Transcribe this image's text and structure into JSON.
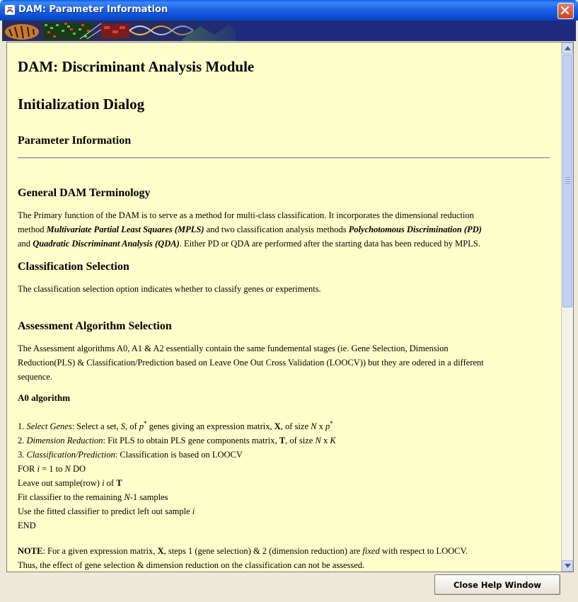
{
  "window": {
    "title": "DAM: Parameter Information"
  },
  "doc": {
    "title": "DAM: Discriminant Analysis Module",
    "subtitle": "Initialization Dialog",
    "section_title": "Parameter Information",
    "terminology": {
      "heading": "General DAM Terminology",
      "line1": "The Primary function of the DAM is to serve as a method for multi-class classification. It incorporates the dimensional reduction",
      "line2_pre": "method ",
      "line2_mpls": "Multivariate Partial Least Squares (MPLS)",
      "line2_mid": " and two classification analysis methods ",
      "line2_pd": "Polychotomous Discrimination (PD)",
      "line3_pre": "and ",
      "line3_qda": "Quadratic Discriminant Analysis (QDA)",
      "line3_post": ". Either PD or QDA are performed after the starting data has been reduced by MPLS."
    },
    "classification": {
      "heading": "Classification Selection",
      "text": "The classification selection option indicates whether to classify genes or experiments."
    },
    "assessment": {
      "heading": "Assessment Algorithm Selection",
      "line1": "The Assessment algorithms A0, A1 & A2 essentially contain the same fundemental stages (ie. Gene Selection, Dimension",
      "line2": "Reduction(PLS) & Classification/Prediction based on Leave One Out Cross Validation (LOOCV)) but they are odered in a different",
      "line3": "sequence."
    },
    "a0": {
      "heading": "A0 algorithm",
      "s1_num": "1. ",
      "s1_label": "Select Genes",
      "s1_a": ": Select a set, ",
      "s1_S": "S",
      "s1_b": ", of ",
      "s1_p": "p",
      "s1_star": "*",
      "s1_c": " genes giving an expression matrix, ",
      "s1_X": "X",
      "s1_d": ", of size ",
      "s1_N": "N",
      "s1_x": " x ",
      "s1_p2": "p",
      "s1_star2": "*",
      "s2_num": "2. ",
      "s2_label": "Dimension Reduction",
      "s2_a": ": Fit PLS to obtain PLS gene components matrix, ",
      "s2_T": "T",
      "s2_b": ", of size ",
      "s2_N": "N",
      "s2_x": " x ",
      "s2_K": "K",
      "s3_num": "3. ",
      "s3_label": "Classification/Prediction",
      "s3_a": ": Classification is based on LOOCV",
      "for_a": "FOR ",
      "for_i": "i",
      "for_b": " = 1 to ",
      "for_N": "N",
      "for_c": " DO",
      "leave_a": "Leave out sample(row) ",
      "leave_i": "i",
      "leave_b": " of ",
      "leave_T": "T",
      "fit_a": "Fit classifier to the remaining ",
      "fit_N": "N",
      "fit_b": "-1 samples",
      "use_a": "Use the fitted classifier to predict left out sample ",
      "use_i": "i",
      "end": "END"
    },
    "note": {
      "label": "NOTE",
      "a": ": For a given expression matrix, ",
      "X": "X",
      "b": ", steps 1 (gene selection) & 2 (dimension reduction) are ",
      "fixed": "fixed",
      "c": " with respect to LOOCV.",
      "line2": "Thus, the effect of gene selection & dimension reduction on the classification can not be assessed."
    }
  },
  "footer": {
    "close_label": "Close Help Window"
  }
}
